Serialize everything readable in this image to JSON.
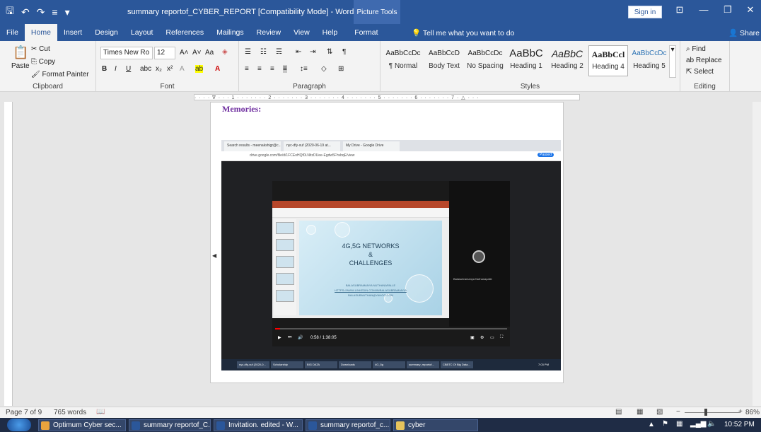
{
  "window": {
    "title": "summary reportof_CYBER_REPORT [Compatibility Mode] - Word",
    "context_tab": "Picture Tools",
    "sign_in": "Sign in",
    "minimize": "—",
    "restore": "❐",
    "close": "✕"
  },
  "tabs": [
    "File",
    "Home",
    "Insert",
    "Design",
    "Layout",
    "References",
    "Mailings",
    "Review",
    "View",
    "Help",
    "Format"
  ],
  "tell_me": "Tell me what you want to do",
  "share": "Share",
  "ribbon": {
    "clipboard": {
      "paste": "Paste",
      "cut": "Cut",
      "copy": "Copy",
      "format_painter": "Format Painter",
      "label": "Clipboard"
    },
    "font": {
      "name": "Times New Ro",
      "size": "12",
      "label": "Font"
    },
    "paragraph": {
      "label": "Paragraph"
    },
    "styles": {
      "label": "Styles",
      "items": [
        {
          "sample": "AaBbCcDc",
          "name": "¶ Normal"
        },
        {
          "sample": "AaBbCcD",
          "name": "Body Text"
        },
        {
          "sample": "AaBbCcDc",
          "name": "No Spacing"
        },
        {
          "sample": "AaBbC",
          "name": "Heading 1"
        },
        {
          "sample": "AaBbC",
          "name": "Heading 2"
        },
        {
          "sample": "AaBbCcl",
          "name": "Heading 4"
        },
        {
          "sample": "AaBbCcDc",
          "name": "Heading 5"
        }
      ]
    },
    "editing": {
      "find": "Find",
      "replace": "Replace",
      "select": "Select",
      "label": "Editing"
    }
  },
  "document": {
    "heading": "Memories:",
    "screenshot": {
      "tabs": [
        "Search results - meenakshigr@c...",
        "nyc-dfy-xuf (2020-06-19 at...",
        "My Drive - Google Drive"
      ],
      "url": "drive.google.com/file/d/1FCEoHQf0LNitzDUee-Egdw5FhvbqE/view",
      "paused": "Paused",
      "slide_title_1": "4G,5G NETWORKS",
      "slide_title_2": "&",
      "slide_title_3": "CHALLENGES",
      "slide_line_1": "BALASUBRAMANYA NUTHANAPALLE",
      "slide_line_2": "HTTPS://WWW.LINKEDIN.COM/IN/BALASUBRAMANYA",
      "slide_line_3": "BALASUBNUTHAN@YAHOO.COM",
      "cam_name": "Balasubramanya Nuthanapalle",
      "video_time": "0:58 / 1:38:05",
      "video_progress": 0.02,
      "taskbar": [
        "nyc-dfy-xuf (2020-0...",
        "Scholarship",
        "BIG DATA",
        "Downloads",
        "4G_5g",
        "summary_reportof...",
        "CBBTC Of Big Data..."
      ],
      "clock": "7:03 PM"
    }
  },
  "status": {
    "page": "Page 7 of 9",
    "words": "765 words",
    "zoom": "86%"
  },
  "taskbar": {
    "items": [
      {
        "label": "Optimum Cyber sec...",
        "color": "#e8a33d"
      },
      {
        "label": "summary reportof_C...",
        "color": "#2b579a"
      },
      {
        "label": "Invitation. edited - W...",
        "color": "#2b579a"
      },
      {
        "label": "summary reportof_c...",
        "color": "#2b579a"
      },
      {
        "label": "cyber",
        "color": "#e6c35c"
      }
    ],
    "clock": "10:52 PM"
  }
}
